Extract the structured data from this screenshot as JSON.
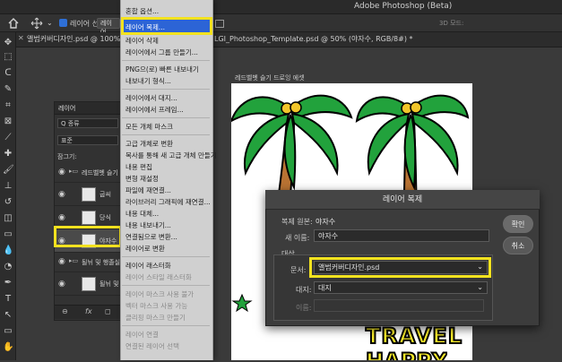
{
  "app": {
    "title": "Adobe Photoshop (Beta)"
  },
  "options_bar": {
    "layer_select_label": "레이어 선택:",
    "layer_select_value": "레이어",
    "mode_3d": "3D 모드:"
  },
  "doc_tabs": [
    {
      "label": "앨범커버디자인.psd @ 100% (..."
    },
    {
      "label": "LGI_Photoshop_Template.psd @ 50% (야자수, RGB/8#) *"
    }
  ],
  "artboard": {
    "label": "레드벨벳 슬기 드로잉 에셋",
    "travel_text": "TRAVEL",
    "happy_text": "HAPPY"
  },
  "layers_panel": {
    "title": "레이어",
    "search": "Q 종류",
    "blend": "표준",
    "lock_label": "잠그기:",
    "rows": [
      {
        "name": "레드벨벳 슬기 드로...",
        "kind": "group"
      },
      {
        "name": "굽씨",
        "kind": "layer"
      },
      {
        "name": "당식",
        "kind": "layer"
      },
      {
        "name": "야자수",
        "kind": "layer",
        "selected": true
      },
      {
        "name": "될뉘 및 행졸실 시...",
        "kind": "group"
      },
      {
        "name": "될뉘 및 행졸...",
        "kind": "layer"
      }
    ],
    "footer": [
      "⊖",
      "fx",
      "◻"
    ]
  },
  "context_menu": {
    "items": [
      {
        "label": "혼합 옵션...",
        "disabled": false
      },
      {
        "label": "레이어 복제...",
        "disabled": false,
        "highlighted": true
      },
      {
        "label": "레이어 삭제",
        "disabled": false
      },
      {
        "label": "레이어에서 그룹 만들기...",
        "disabled": false
      },
      {
        "label": "PNG으(로) 빠른 내보내기",
        "disabled": false
      },
      {
        "label": "내보내기 형식...",
        "disabled": false
      },
      {
        "label": "레이어에서 대지...",
        "disabled": false
      },
      {
        "label": "레이어에서 프레임...",
        "disabled": false
      },
      {
        "label": "모든 개체 마스크",
        "disabled": false
      },
      {
        "label": "고급 개체로 변환",
        "disabled": false
      },
      {
        "label": "복사를 통해 새 고급 개체 만들기",
        "disabled": false
      },
      {
        "label": "내용 편집",
        "disabled": false
      },
      {
        "label": "변형 재설정",
        "disabled": false
      },
      {
        "label": "파일에 재연결...",
        "disabled": false
      },
      {
        "label": "라이브러리 그래픽에 재연결...",
        "disabled": false
      },
      {
        "label": "내용 대체...",
        "disabled": false
      },
      {
        "label": "내용 내보내기...",
        "disabled": false
      },
      {
        "label": "연결됨으로 변환...",
        "disabled": false
      },
      {
        "label": "레이어로 변환",
        "disabled": false
      },
      {
        "label": "레이어 래스터화",
        "disabled": false
      },
      {
        "label": "레이어 스타일 래스터화",
        "disabled": true
      },
      {
        "label": "레이어 마스크 사용 불가",
        "disabled": true
      },
      {
        "label": "벡터 마스크 사용 가능",
        "disabled": true
      },
      {
        "label": "클리핑 마스크 만들기",
        "disabled": true
      },
      {
        "label": "레이어 연결",
        "disabled": true
      },
      {
        "label": "연결된 레이어 선택",
        "disabled": true
      }
    ]
  },
  "duplicate_dialog": {
    "title": "레이어 복제",
    "source_label": "복제 원본:",
    "source_value": "야자수",
    "name_label": "새 이름:",
    "name_value": "야자수",
    "target_section": "대상",
    "document_label": "문서:",
    "document_value": "앨범커버디자인.psd",
    "artboard_label": "대지:",
    "artboard_value": "대지",
    "layer_name_label": "이름:",
    "ok_label": "확인",
    "cancel_label": "취소"
  },
  "colors": {
    "highlight": "#2c64d6",
    "annotation": "#f3e21f",
    "dialog_bg": "#3c3c3c"
  }
}
